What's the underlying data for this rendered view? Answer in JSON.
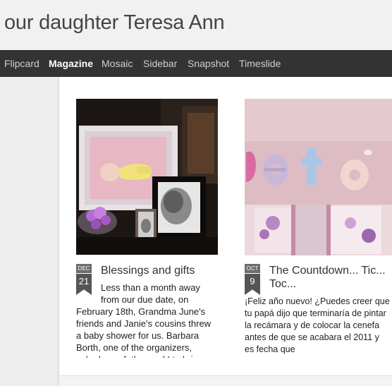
{
  "blog": {
    "title": "our daughter Teresa Ann"
  },
  "nav": {
    "items": [
      {
        "label": "Flipcard"
      },
      {
        "label": "Magazine"
      },
      {
        "label": "Mosaic"
      },
      {
        "label": "Sidebar"
      },
      {
        "label": "Snapshot"
      },
      {
        "label": "Timeslide"
      }
    ]
  },
  "posts": [
    {
      "month": "DEC",
      "day": "21",
      "title": "Blessings and gifts",
      "snippet_indent": "Less than a month away from our due date, on",
      "snippet": "February 18th, Grandma June's friends and Janie's cousins threw a baby shower for us. Barbara Borth, one of the organizers, asked your father and I to bring a"
    },
    {
      "month": "OCT",
      "day": "9",
      "title": "The Countdown... Tic... Toc...",
      "snippet": "¡Feliz año nuevo! ¿Puedes creer que tu papá dijo que terminaría de pintar la recámara y de colocar la cenefa antes de que se acabara el 2011 y es fecha que"
    }
  ]
}
